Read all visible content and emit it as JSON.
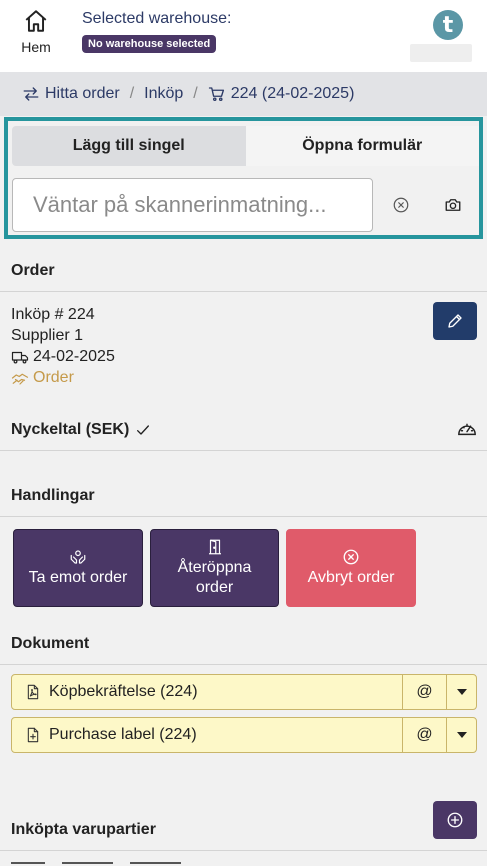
{
  "header": {
    "home_label": "Hem",
    "warehouse_title": "Selected warehouse:",
    "warehouse_badge": "No warehouse selected",
    "logo_letter": "t"
  },
  "breadcrumb": {
    "items": [
      {
        "label": "Hitta order",
        "icon": "swap-arrows-icon"
      },
      {
        "label": "Inköp"
      },
      {
        "label": "224 (24-02-2025)",
        "icon": "cart-icon"
      }
    ]
  },
  "scan": {
    "tabs": [
      {
        "label": "Lägg till singel",
        "active": true
      },
      {
        "label": "Öppna formulär",
        "active": false
      }
    ],
    "placeholder": "Väntar på skannerinmatning..."
  },
  "order": {
    "section_title": "Order",
    "title": "Inköp # 224",
    "supplier": "Supplier 1",
    "date": "24-02-2025",
    "status": "Order"
  },
  "kpi": {
    "title": "Nyckeltal (SEK)"
  },
  "actions": {
    "section_title": "Handlingar",
    "receive": "Ta emot order",
    "reopen_line1": "Återöppna",
    "reopen_line2": "order",
    "cancel": "Avbryt order"
  },
  "documents": {
    "section_title": "Dokument",
    "items": [
      {
        "label": "Köpbekräftelse (224)",
        "at": "@"
      },
      {
        "label": "Purchase label (224)",
        "at": "@"
      }
    ]
  },
  "lots": {
    "section_title": "Inköpta varupartier"
  },
  "colors": {
    "primary": "#4a3766",
    "teal": "#26959d",
    "navy": "#223c6a",
    "danger": "#e05b6a",
    "doc_bg": "#fdf8c8",
    "status": "#c59a4a"
  }
}
